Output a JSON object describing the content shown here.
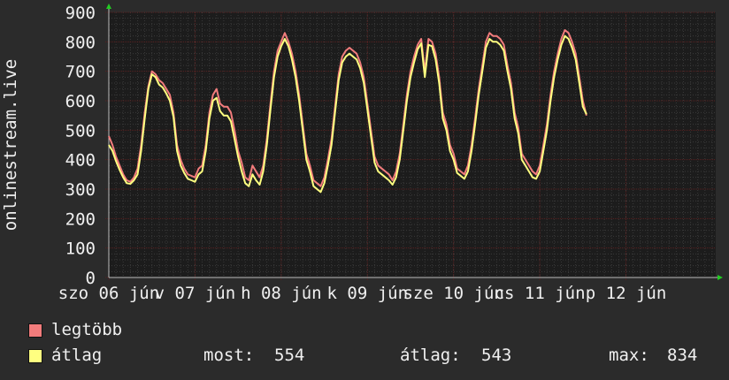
{
  "colors": {
    "background": "#2b2b2b",
    "plot_background": "#1c1c1c",
    "grid_major": "#5a2020",
    "grid_minor": "#3a3a3a",
    "axis": "#bdbdbd",
    "arrow": "#22cc22",
    "text": "#f0f0f0",
    "max_series": "#f27c7c",
    "avg_series": "#ffff80"
  },
  "legend": {
    "max_label": "legtöbb",
    "avg_label": "átlag",
    "current_label": "most:",
    "current_value": "554",
    "average_label": "átlag:",
    "average_value": "543",
    "maximum_label": "max:",
    "maximum_value": "834"
  },
  "chart_data": {
    "type": "line",
    "ylabel": "onlinestream.live",
    "ylim": [
      0,
      900
    ],
    "yticks": [
      "0",
      "100",
      "200",
      "300",
      "400",
      "500",
      "600",
      "700",
      "800",
      "900"
    ],
    "xlim": [
      0,
      169
    ],
    "xticks": [
      {
        "label": "szo 06 jún",
        "x": 0
      },
      {
        "label": "v 07 jún",
        "x": 24
      },
      {
        "label": "h 08 jún",
        "x": 48
      },
      {
        "label": "k 09 jún",
        "x": 72
      },
      {
        "label": "sze 10 jún",
        "x": 96
      },
      {
        "label": "cs 11 jún",
        "x": 120
      },
      {
        "label": "p 12 jún",
        "x": 144
      }
    ],
    "series": [
      {
        "name": "legtöbb",
        "color": "#f27c7c",
        "points": [
          [
            0,
            480
          ],
          [
            1,
            450
          ],
          [
            2,
            410
          ],
          [
            3,
            380
          ],
          [
            4,
            350
          ],
          [
            5,
            330
          ],
          [
            6,
            325
          ],
          [
            7,
            340
          ],
          [
            8,
            370
          ],
          [
            9,
            450
          ],
          [
            10,
            560
          ],
          [
            11,
            650
          ],
          [
            12,
            700
          ],
          [
            13,
            690
          ],
          [
            14,
            670
          ],
          [
            15,
            660
          ],
          [
            16,
            640
          ],
          [
            17,
            620
          ],
          [
            18,
            560
          ],
          [
            19,
            450
          ],
          [
            20,
            400
          ],
          [
            21,
            370
          ],
          [
            22,
            350
          ],
          [
            23,
            345
          ],
          [
            24,
            340
          ],
          [
            25,
            370
          ],
          [
            26,
            380
          ],
          [
            27,
            450
          ],
          [
            28,
            560
          ],
          [
            29,
            620
          ],
          [
            30,
            640
          ],
          [
            31,
            590
          ],
          [
            32,
            580
          ],
          [
            33,
            580
          ],
          [
            34,
            560
          ],
          [
            35,
            500
          ],
          [
            36,
            430
          ],
          [
            37,
            390
          ],
          [
            38,
            340
          ],
          [
            39,
            330
          ],
          [
            40,
            380
          ],
          [
            41,
            360
          ],
          [
            42,
            340
          ],
          [
            43,
            380
          ],
          [
            44,
            470
          ],
          [
            45,
            590
          ],
          [
            46,
            700
          ],
          [
            47,
            770
          ],
          [
            48,
            800
          ],
          [
            49,
            830
          ],
          [
            50,
            800
          ],
          [
            51,
            760
          ],
          [
            52,
            700
          ],
          [
            53,
            620
          ],
          [
            54,
            520
          ],
          [
            55,
            420
          ],
          [
            56,
            380
          ],
          [
            57,
            330
          ],
          [
            58,
            320
          ],
          [
            59,
            310
          ],
          [
            60,
            340
          ],
          [
            61,
            400
          ],
          [
            62,
            470
          ],
          [
            63,
            580
          ],
          [
            64,
            690
          ],
          [
            65,
            750
          ],
          [
            66,
            770
          ],
          [
            67,
            780
          ],
          [
            68,
            770
          ],
          [
            69,
            760
          ],
          [
            70,
            730
          ],
          [
            71,
            680
          ],
          [
            72,
            590
          ],
          [
            73,
            500
          ],
          [
            74,
            410
          ],
          [
            75,
            380
          ],
          [
            76,
            370
          ],
          [
            77,
            360
          ],
          [
            78,
            350
          ],
          [
            79,
            330
          ],
          [
            80,
            360
          ],
          [
            81,
            420
          ],
          [
            82,
            520
          ],
          [
            83,
            620
          ],
          [
            84,
            700
          ],
          [
            85,
            750
          ],
          [
            86,
            790
          ],
          [
            87,
            810
          ],
          [
            88,
            700
          ],
          [
            89,
            810
          ],
          [
            90,
            800
          ],
          [
            91,
            760
          ],
          [
            92,
            680
          ],
          [
            93,
            560
          ],
          [
            94,
            520
          ],
          [
            95,
            450
          ],
          [
            96,
            420
          ],
          [
            97,
            370
          ],
          [
            98,
            360
          ],
          [
            99,
            350
          ],
          [
            100,
            380
          ],
          [
            101,
            450
          ],
          [
            102,
            540
          ],
          [
            103,
            640
          ],
          [
            104,
            720
          ],
          [
            105,
            800
          ],
          [
            106,
            830
          ],
          [
            107,
            820
          ],
          [
            108,
            820
          ],
          [
            109,
            810
          ],
          [
            110,
            790
          ],
          [
            111,
            720
          ],
          [
            112,
            660
          ],
          [
            113,
            560
          ],
          [
            114,
            510
          ],
          [
            115,
            420
          ],
          [
            116,
            400
          ],
          [
            117,
            380
          ],
          [
            118,
            360
          ],
          [
            119,
            350
          ],
          [
            120,
            380
          ],
          [
            121,
            450
          ],
          [
            122,
            520
          ],
          [
            123,
            620
          ],
          [
            124,
            700
          ],
          [
            125,
            760
          ],
          [
            126,
            810
          ],
          [
            127,
            840
          ],
          [
            128,
            830
          ],
          [
            129,
            800
          ],
          [
            130,
            760
          ],
          [
            131,
            680
          ],
          [
            132,
            600
          ],
          [
            133,
            550
          ]
        ]
      },
      {
        "name": "átlag",
        "color": "#ffff80",
        "points": [
          [
            0,
            450
          ],
          [
            1,
            430
          ],
          [
            2,
            395
          ],
          [
            3,
            365
          ],
          [
            4,
            340
          ],
          [
            5,
            320
          ],
          [
            6,
            318
          ],
          [
            7,
            330
          ],
          [
            8,
            350
          ],
          [
            9,
            430
          ],
          [
            10,
            540
          ],
          [
            11,
            640
          ],
          [
            12,
            690
          ],
          [
            13,
            680
          ],
          [
            14,
            655
          ],
          [
            15,
            645
          ],
          [
            16,
            625
          ],
          [
            17,
            600
          ],
          [
            18,
            545
          ],
          [
            19,
            430
          ],
          [
            20,
            380
          ],
          [
            21,
            355
          ],
          [
            22,
            335
          ],
          [
            23,
            330
          ],
          [
            24,
            325
          ],
          [
            25,
            350
          ],
          [
            26,
            360
          ],
          [
            27,
            430
          ],
          [
            28,
            540
          ],
          [
            29,
            600
          ],
          [
            30,
            610
          ],
          [
            31,
            565
          ],
          [
            32,
            550
          ],
          [
            33,
            550
          ],
          [
            34,
            530
          ],
          [
            35,
            470
          ],
          [
            36,
            410
          ],
          [
            37,
            360
          ],
          [
            38,
            320
          ],
          [
            39,
            310
          ],
          [
            40,
            350
          ],
          [
            41,
            330
          ],
          [
            42,
            315
          ],
          [
            43,
            360
          ],
          [
            44,
            450
          ],
          [
            45,
            570
          ],
          [
            46,
            680
          ],
          [
            47,
            750
          ],
          [
            48,
            785
          ],
          [
            49,
            810
          ],
          [
            50,
            785
          ],
          [
            51,
            740
          ],
          [
            52,
            680
          ],
          [
            53,
            600
          ],
          [
            54,
            500
          ],
          [
            55,
            400
          ],
          [
            56,
            360
          ],
          [
            57,
            310
          ],
          [
            58,
            300
          ],
          [
            59,
            290
          ],
          [
            60,
            320
          ],
          [
            61,
            380
          ],
          [
            62,
            450
          ],
          [
            63,
            560
          ],
          [
            64,
            670
          ],
          [
            65,
            730
          ],
          [
            66,
            750
          ],
          [
            67,
            760
          ],
          [
            68,
            750
          ],
          [
            69,
            740
          ],
          [
            70,
            710
          ],
          [
            71,
            660
          ],
          [
            72,
            570
          ],
          [
            73,
            480
          ],
          [
            74,
            390
          ],
          [
            75,
            360
          ],
          [
            76,
            350
          ],
          [
            77,
            340
          ],
          [
            78,
            330
          ],
          [
            79,
            315
          ],
          [
            80,
            340
          ],
          [
            81,
            400
          ],
          [
            82,
            500
          ],
          [
            83,
            600
          ],
          [
            84,
            680
          ],
          [
            85,
            730
          ],
          [
            86,
            775
          ],
          [
            87,
            795
          ],
          [
            88,
            680
          ],
          [
            89,
            790
          ],
          [
            90,
            785
          ],
          [
            91,
            740
          ],
          [
            92,
            660
          ],
          [
            93,
            540
          ],
          [
            94,
            500
          ],
          [
            95,
            430
          ],
          [
            96,
            400
          ],
          [
            97,
            355
          ],
          [
            98,
            345
          ],
          [
            99,
            335
          ],
          [
            100,
            360
          ],
          [
            101,
            430
          ],
          [
            102,
            520
          ],
          [
            103,
            620
          ],
          [
            104,
            700
          ],
          [
            105,
            780
          ],
          [
            106,
            810
          ],
          [
            107,
            800
          ],
          [
            108,
            800
          ],
          [
            109,
            790
          ],
          [
            110,
            770
          ],
          [
            111,
            700
          ],
          [
            112,
            640
          ],
          [
            113,
            540
          ],
          [
            114,
            490
          ],
          [
            115,
            400
          ],
          [
            116,
            380
          ],
          [
            117,
            360
          ],
          [
            118,
            340
          ],
          [
            119,
            335
          ],
          [
            120,
            360
          ],
          [
            121,
            430
          ],
          [
            122,
            500
          ],
          [
            123,
            600
          ],
          [
            124,
            680
          ],
          [
            125,
            740
          ],
          [
            126,
            790
          ],
          [
            127,
            820
          ],
          [
            128,
            810
          ],
          [
            129,
            780
          ],
          [
            130,
            740
          ],
          [
            131,
            660
          ],
          [
            132,
            580
          ],
          [
            133,
            554
          ]
        ]
      }
    ]
  }
}
